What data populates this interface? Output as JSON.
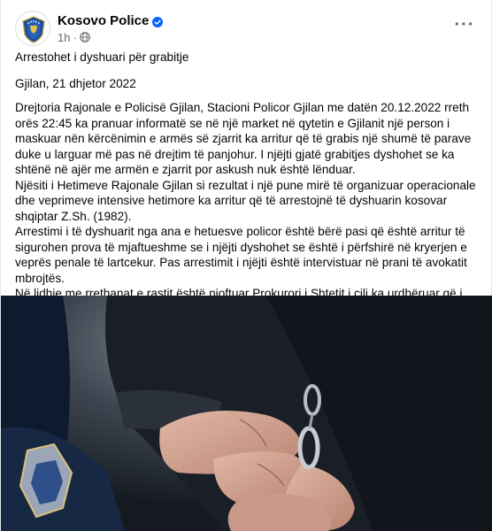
{
  "post": {
    "page_name": "Kosovo Police",
    "time": "1h",
    "separator": "·",
    "title": "Arrestohet i dyshuari për grabitje",
    "dateline": "Gjilan, 21 dhjetor 2022",
    "paragraphs": [
      "Drejtoria Rajonale e Policisë Gjilan, Stacioni Policor Gjilan me datën 20.12.2022 rreth orës 22:45 ka pranuar informatë se në një market në qytetin e Gjilanit një person i maskuar nën kërcënimin e armës së zjarrit ka arritur që të grabis një shumë të parave duke u larguar më pas në drejtim të panjohur. I njëjti gjatë grabitjes dyshohet se ka shtënë në ajër me armën e zjarrit por askush nuk është lënduar.",
      "Njësiti i Hetimeve Rajonale Gjilan si rezultat i një pune mirë të organizuar operacionale dhe veprimeve intensive hetimore ka arritur që të arrestojnë të dyshuarin kosovar shqiptar Z.Sh. (1982).",
      "Arrestimi i të dyshuarit nga ana e hetuesve policor është bërë pasi që është arritur të sigurohen prova të mjaftueshme se i njëjti dyshohet se është i përfshirë në kryerjen e veprës penale të lartcekur. Pas arrestimit i njëjti është intervistuar në prani të avokatit mbrojtës.",
      "Në lidhje me rrethanat e rastit është njoftuar Prokurori i Shtetit i cili ka urdhëruar që i dyshuarit të ndalet në mbajtje për 48 orë për veprën penale ''Grabitje'' dhe rasti me kallëzim penal do të procedohet në Prokurorinë Themelore Gjilan."
    ]
  },
  "icons": {
    "avatar": "kosovo-police-logo",
    "verified": "verified-badge-icon",
    "privacy": "globe-icon",
    "more": "more-options-icon"
  },
  "colors": {
    "verified_blue": "#0866ff",
    "secondary_text": "#65676b",
    "primary_text": "#050505"
  }
}
